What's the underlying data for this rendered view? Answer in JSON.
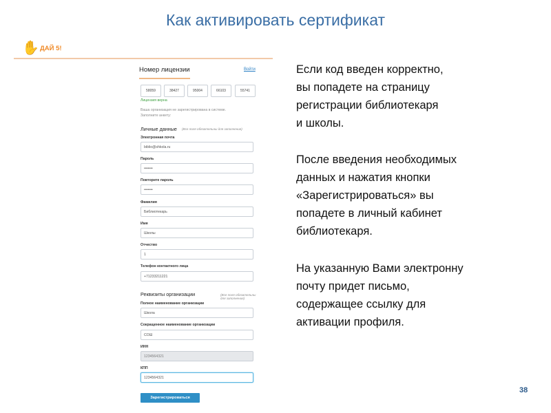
{
  "slide": {
    "title": "Как активировать сертификат",
    "page_number": "38"
  },
  "logo": {
    "text": "ДАЙ 5!"
  },
  "form": {
    "license_title": "Номер лицензии",
    "login_link": "Войти",
    "license_codes": [
      "58059",
      "38427",
      "95004",
      "66103",
      "55741"
    ],
    "valid_message": "Лицензия верна",
    "notice_line1": "Ваша организация не зарегистрирована в системе.",
    "notice_line2": "Заполните анкету:",
    "personal_section": {
      "title": "Личные данные",
      "note": "(Все поля обязательны для заполнения)",
      "fields": [
        {
          "label": "Электронная почта",
          "value": "biblio@shkola.ru"
        },
        {
          "label": "Пароль",
          "value": "•••••••"
        },
        {
          "label": "Повторите пароль",
          "value": "•••••••"
        },
        {
          "label": "Фамилия",
          "value": "Библиотекарь"
        },
        {
          "label": "Имя",
          "value": "Школы"
        },
        {
          "label": "Отчество",
          "value": "1"
        },
        {
          "label": "Телефон контактного лица",
          "value": "+71233211221"
        }
      ]
    },
    "org_section": {
      "title": "Реквизиты организации",
      "note": "(Все поля обязательны для заполнения)",
      "fields": [
        {
          "label": "Полное наименование организации",
          "value": "Школа"
        },
        {
          "label": "Сокращенное наименование организации",
          "value": "СОШ"
        },
        {
          "label": "ИНН",
          "value": "1234564321",
          "disabled": true
        },
        {
          "label": "КПП",
          "value": "1234564321",
          "focused": true
        }
      ]
    },
    "submit_label": "Зарегистрироваться"
  },
  "text": {
    "paragraph1": [
      "Если код введен корректно,",
      "вы попадете на страницу",
      "регистрации библиотекаря",
      "и школы."
    ],
    "paragraph2": [
      "После введения необходимых",
      "данных и нажатия кнопки",
      "«Зарегистрироваться» вы",
      "попадете в личный кабинет",
      "библиотекаря."
    ],
    "paragraph3": [
      "На указанную Вами электронну",
      "почту придет письмо,",
      "содержащее ссылку для",
      "активации профиля."
    ]
  },
  "colors": {
    "title": "#3a6ea5",
    "accent_orange": "#f08a28",
    "link_blue": "#2a7fc4",
    "button_blue": "#2f8fc6",
    "valid_green": "#3ea040"
  }
}
